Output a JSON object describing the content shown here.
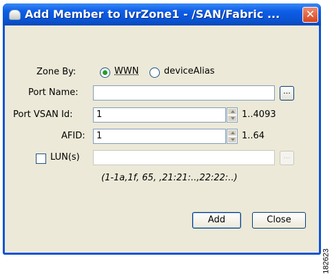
{
  "window": {
    "title": "Add Member to IvrZone1 - /SAN/Fabric ..."
  },
  "form": {
    "zone_by_label": "Zone By:",
    "zone_by_options": [
      "WWN",
      "deviceAlias"
    ],
    "zone_by_selected": "WWN",
    "port_name_label": "Port Name:",
    "port_name_value": "",
    "port_vsan_label": "Port VSAN Id:",
    "port_vsan_value": "1",
    "port_vsan_range": "1..4093",
    "afid_label": "AFID:",
    "afid_value": "1",
    "afid_range": "1..64",
    "lun_label": "LUN(s)",
    "lun_checked": false,
    "lun_value": "",
    "lun_hint": "(1-1a,1f, 65, ,21:21:..,22:22:..)",
    "dots": "..."
  },
  "buttons": {
    "add": "Add",
    "close": "Close"
  },
  "figure_id": "182623"
}
